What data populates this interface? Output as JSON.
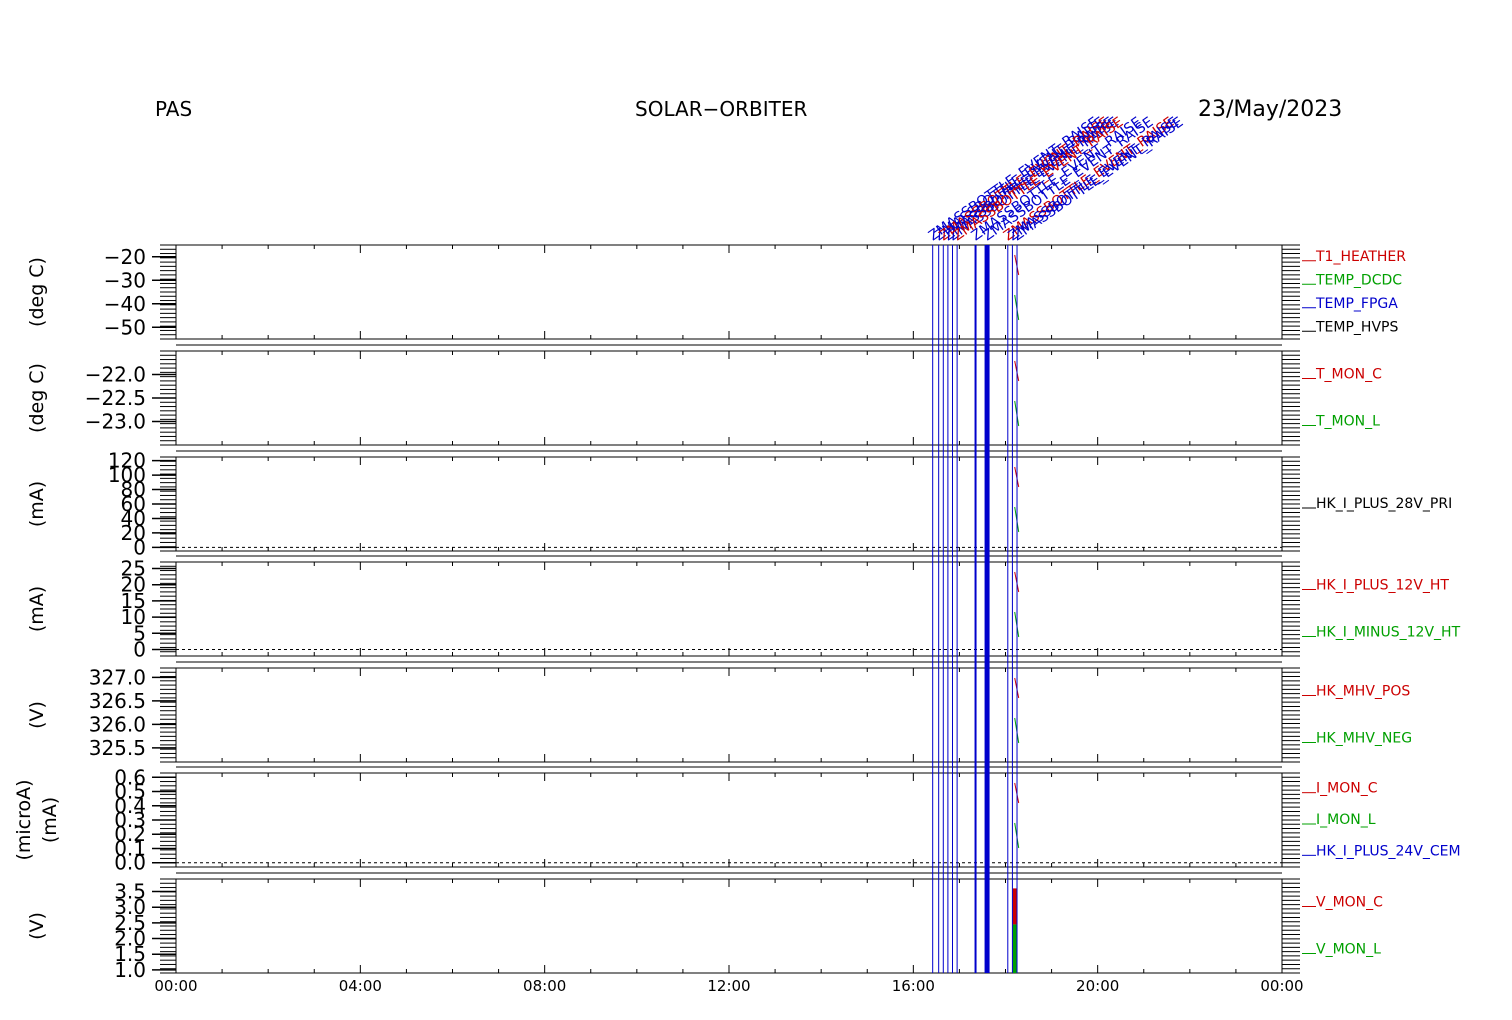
{
  "header": {
    "left": "PAS",
    "center": "SOLAR−ORBITER",
    "right": "23/May/2023"
  },
  "colors": {
    "axis": "#000000",
    "red": "#cc0000",
    "green": "#00a000",
    "blue": "#0000cc",
    "black": "#000000",
    "event_line": "#0000cc"
  },
  "event_label_text": "ZMASSBOTTLE_EVENT_RAISE",
  "chart_data": {
    "type": "line",
    "x_axis": {
      "range": [
        "00:00",
        "24:00"
      ],
      "tick_labels": [
        "00:00",
        "04:00",
        "08:00",
        "12:00",
        "16:00",
        "20:00",
        "00:00"
      ]
    },
    "event_times_hours": [
      16.42,
      16.55,
      16.65,
      16.75,
      16.85,
      16.95,
      17.35,
      17.6,
      18.05,
      18.15,
      18.25
    ],
    "panels": [
      {
        "ylabel": "(deg C)",
        "ylim": [
          -55,
          -15
        ],
        "tick_labels": [
          -20,
          -30,
          -40,
          -50
        ],
        "series": [
          {
            "name": "T1_HEATHER",
            "color": "red"
          },
          {
            "name": "TEMP_DCDC",
            "color": "green"
          },
          {
            "name": "TEMP_FPGA",
            "color": "blue"
          },
          {
            "name": "TEMP_HVPS",
            "color": "black"
          }
        ]
      },
      {
        "ylabel": "(deg C)",
        "ylim": [
          -23.5,
          -21.5
        ],
        "tick_labels": [
          "-22.0",
          "-22.5",
          "-23.0"
        ],
        "series": [
          {
            "name": "T_MON_C",
            "color": "red"
          },
          {
            "name": "T_MON_L",
            "color": "green"
          }
        ]
      },
      {
        "ylabel": "(mA)",
        "ylim": [
          -5,
          125
        ],
        "tick_labels": [
          120,
          100,
          80,
          60,
          40,
          20,
          0
        ],
        "series": [
          {
            "name": "HK_I_PLUS_28V_PRI",
            "color": "black"
          }
        ]
      },
      {
        "ylabel": "(mA)",
        "ylim": [
          -2,
          27
        ],
        "tick_labels": [
          25,
          20,
          15,
          10,
          5,
          0
        ],
        "series": [
          {
            "name": "HK_I_PLUS_12V_HT",
            "color": "red"
          },
          {
            "name": "HK_I_MINUS_12V_HT",
            "color": "green"
          }
        ]
      },
      {
        "ylabel": "(V)",
        "ylim": [
          325.2,
          327.2
        ],
        "tick_labels": [
          "327.0",
          "326.5",
          "326.0",
          "325.5"
        ],
        "series": [
          {
            "name": "HK_MHV_POS",
            "color": "red"
          },
          {
            "name": "HK_MHV_NEG",
            "color": "green"
          }
        ]
      },
      {
        "ylabel": "(microA)",
        "ylabel2": "(mA)",
        "ylim": [
          -0.03,
          0.63
        ],
        "tick_labels": [
          "0.6",
          "0.5",
          "0.4",
          "0.3",
          "0.2",
          "0.1",
          "0.0"
        ],
        "series": [
          {
            "name": "I_MON_C",
            "color": "red"
          },
          {
            "name": "I_MON_L",
            "color": "green"
          },
          {
            "name": "HK_I_PLUS_24V_CEM",
            "color": "blue"
          }
        ]
      },
      {
        "ylabel": "(V)",
        "ylim": [
          0.9,
          3.9
        ],
        "tick_labels": [
          "3.5",
          "3.0",
          "2.5",
          "2.0",
          "1.5",
          "1.0"
        ],
        "series": [
          {
            "name": "V_MON_C",
            "color": "red"
          },
          {
            "name": "V_MON_L",
            "color": "green"
          }
        ]
      }
    ]
  }
}
